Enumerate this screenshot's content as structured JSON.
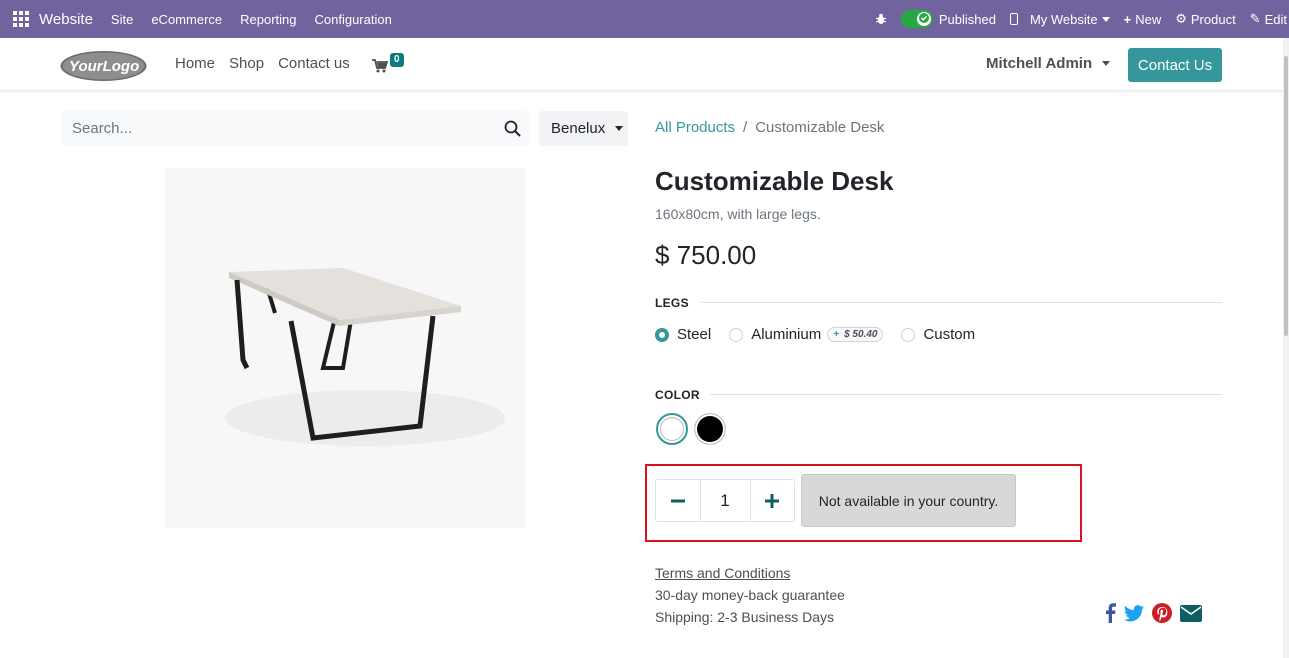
{
  "admin_bar": {
    "app_name": "Website",
    "menu": [
      "Site",
      "eCommerce",
      "Reporting",
      "Configuration"
    ],
    "published_label": "Published",
    "my_website_label": "My Website",
    "new_label": "New",
    "product_label": "Product",
    "edit_label": "Edit"
  },
  "header": {
    "logo_text": "YourLogo",
    "nav": [
      "Home",
      "Shop",
      "Contact us"
    ],
    "cart_count": "0",
    "user_name": "Mitchell Admin",
    "contact_button": "Contact Us"
  },
  "search": {
    "placeholder": "Search...",
    "pricelist": "Benelux"
  },
  "breadcrumb": {
    "parent": "All Products",
    "separator": "/",
    "current": "Customizable Desk"
  },
  "product": {
    "name": "Customizable Desk",
    "description": "160x80cm, with large legs.",
    "price": "$ 750.00",
    "attributes": {
      "legs": {
        "label": "LEGS",
        "options": [
          {
            "label": "Steel",
            "checked": true
          },
          {
            "label": "Aluminium",
            "extra_sign": "+",
            "extra": "$ 50.40",
            "checked": false
          },
          {
            "label": "Custom",
            "checked": false
          }
        ]
      },
      "color": {
        "label": "COLOR",
        "swatches": [
          {
            "name": "White",
            "color": "#ffffff",
            "selected": true
          },
          {
            "name": "Black",
            "color": "#000000",
            "selected": false
          }
        ]
      }
    },
    "quantity": "1",
    "unavailable_label": "Not available in your country.",
    "terms_link": "Terms and Conditions",
    "guarantee": "30-day money-back guarantee",
    "shipping": "Shipping: 2-3 Business Days"
  },
  "colors": {
    "admin_bar": "#71639e",
    "primary": "#35979c",
    "highlight": "#d9141f"
  }
}
